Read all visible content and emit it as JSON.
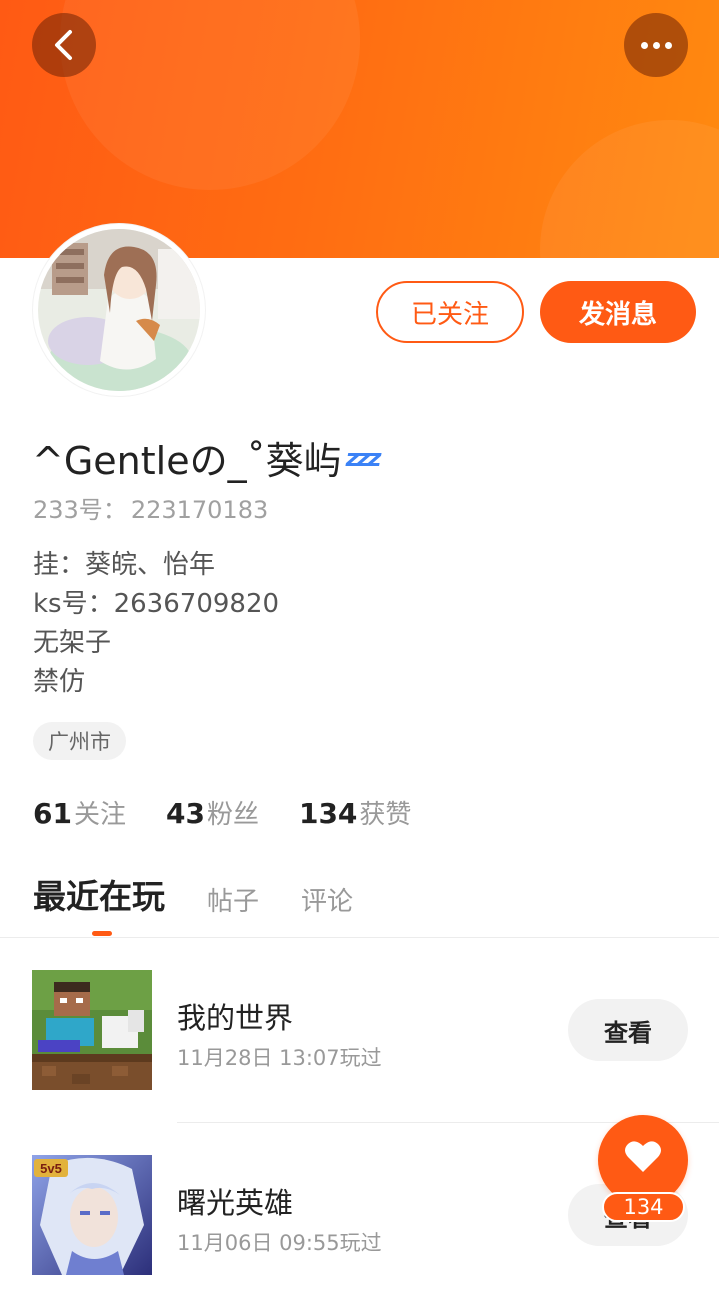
{
  "header": {
    "back_icon": "chevron-left-icon",
    "more_icon": "more-dots-icon",
    "banner_color": "#ff6d12"
  },
  "profile": {
    "follow_label": "已关注",
    "message_label": "发消息",
    "username": "^Gentleの_˚葵屿",
    "sleep_emoji": "zzz",
    "id_label": "233号",
    "id_value": "223170183",
    "bio": [
      "挂：葵皖、怡年",
      "ks号：2636709820",
      "无架子",
      "禁仿"
    ],
    "location": "广州市"
  },
  "stats": [
    {
      "num": "61",
      "label": "关注"
    },
    {
      "num": "43",
      "label": "粉丝"
    },
    {
      "num": "134",
      "label": "获赞"
    }
  ],
  "tabs": [
    "最近在玩",
    "帖子",
    "评论"
  ],
  "games": [
    {
      "name": "我的世界",
      "time": "11月28日 13:07玩过",
      "button": "查看"
    },
    {
      "name": "曙光英雄",
      "time": "11月06日 09:55玩过",
      "button": "查看"
    }
  ],
  "like_fab": {
    "icon": "heart-icon",
    "count": "134"
  },
  "colors": {
    "accent": "#ff5a14",
    "muted_text": "#999999",
    "pill_bg": "#f2f2f2"
  }
}
